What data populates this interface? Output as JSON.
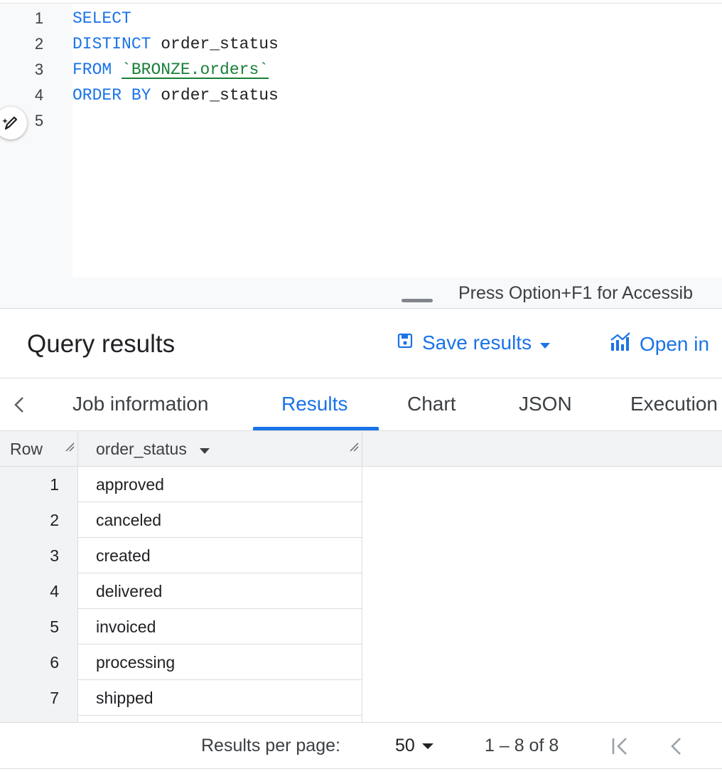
{
  "editor": {
    "lines": [
      {
        "n": "1",
        "tokens": [
          {
            "t": "SELECT",
            "k": "kw"
          }
        ]
      },
      {
        "n": "2",
        "tokens": [
          {
            "t": "DISTINCT",
            "k": "kw"
          },
          {
            "t": " order_status",
            "k": "id"
          }
        ]
      },
      {
        "n": "3",
        "tokens": [
          {
            "t": "FROM",
            "k": "kw"
          },
          {
            "t": " ",
            "k": "id"
          },
          {
            "t": "`BRONZE.orders`",
            "k": "str"
          }
        ]
      },
      {
        "n": "4",
        "tokens": [
          {
            "t": "ORDER BY",
            "k": "kw"
          },
          {
            "t": " order_status",
            "k": "id"
          }
        ]
      },
      {
        "n": "5",
        "tokens": []
      }
    ],
    "accessibility_hint": "Press Option+F1 for Accessib",
    "assist_icon": "pen-sparkle-icon"
  },
  "results": {
    "title": "Query results",
    "save_label": "Save results",
    "open_label": "Open in",
    "save_icon": "save-icon",
    "open_icon": "chart-icon"
  },
  "tabs": [
    {
      "label": "Job information",
      "active": false
    },
    {
      "label": "Results",
      "active": true
    },
    {
      "label": "Chart",
      "active": false
    },
    {
      "label": "JSON",
      "active": false
    },
    {
      "label": "Execution",
      "active": false
    }
  ],
  "grid": {
    "row_header": "Row",
    "column_header": "order_status",
    "rows": [
      {
        "num": "1",
        "value": "approved"
      },
      {
        "num": "2",
        "value": "canceled"
      },
      {
        "num": "3",
        "value": "created"
      },
      {
        "num": "4",
        "value": "delivered"
      },
      {
        "num": "5",
        "value": "invoiced"
      },
      {
        "num": "6",
        "value": "processing"
      },
      {
        "num": "7",
        "value": "shipped"
      }
    ]
  },
  "pagination": {
    "per_page_label": "Results per page:",
    "per_page_value": "50",
    "range": "1 – 8 of 8"
  },
  "colors": {
    "accent": "#1a73e8",
    "keyword": "#1a73e8",
    "string": "#188038",
    "header_bg": "#f1f3f4"
  }
}
